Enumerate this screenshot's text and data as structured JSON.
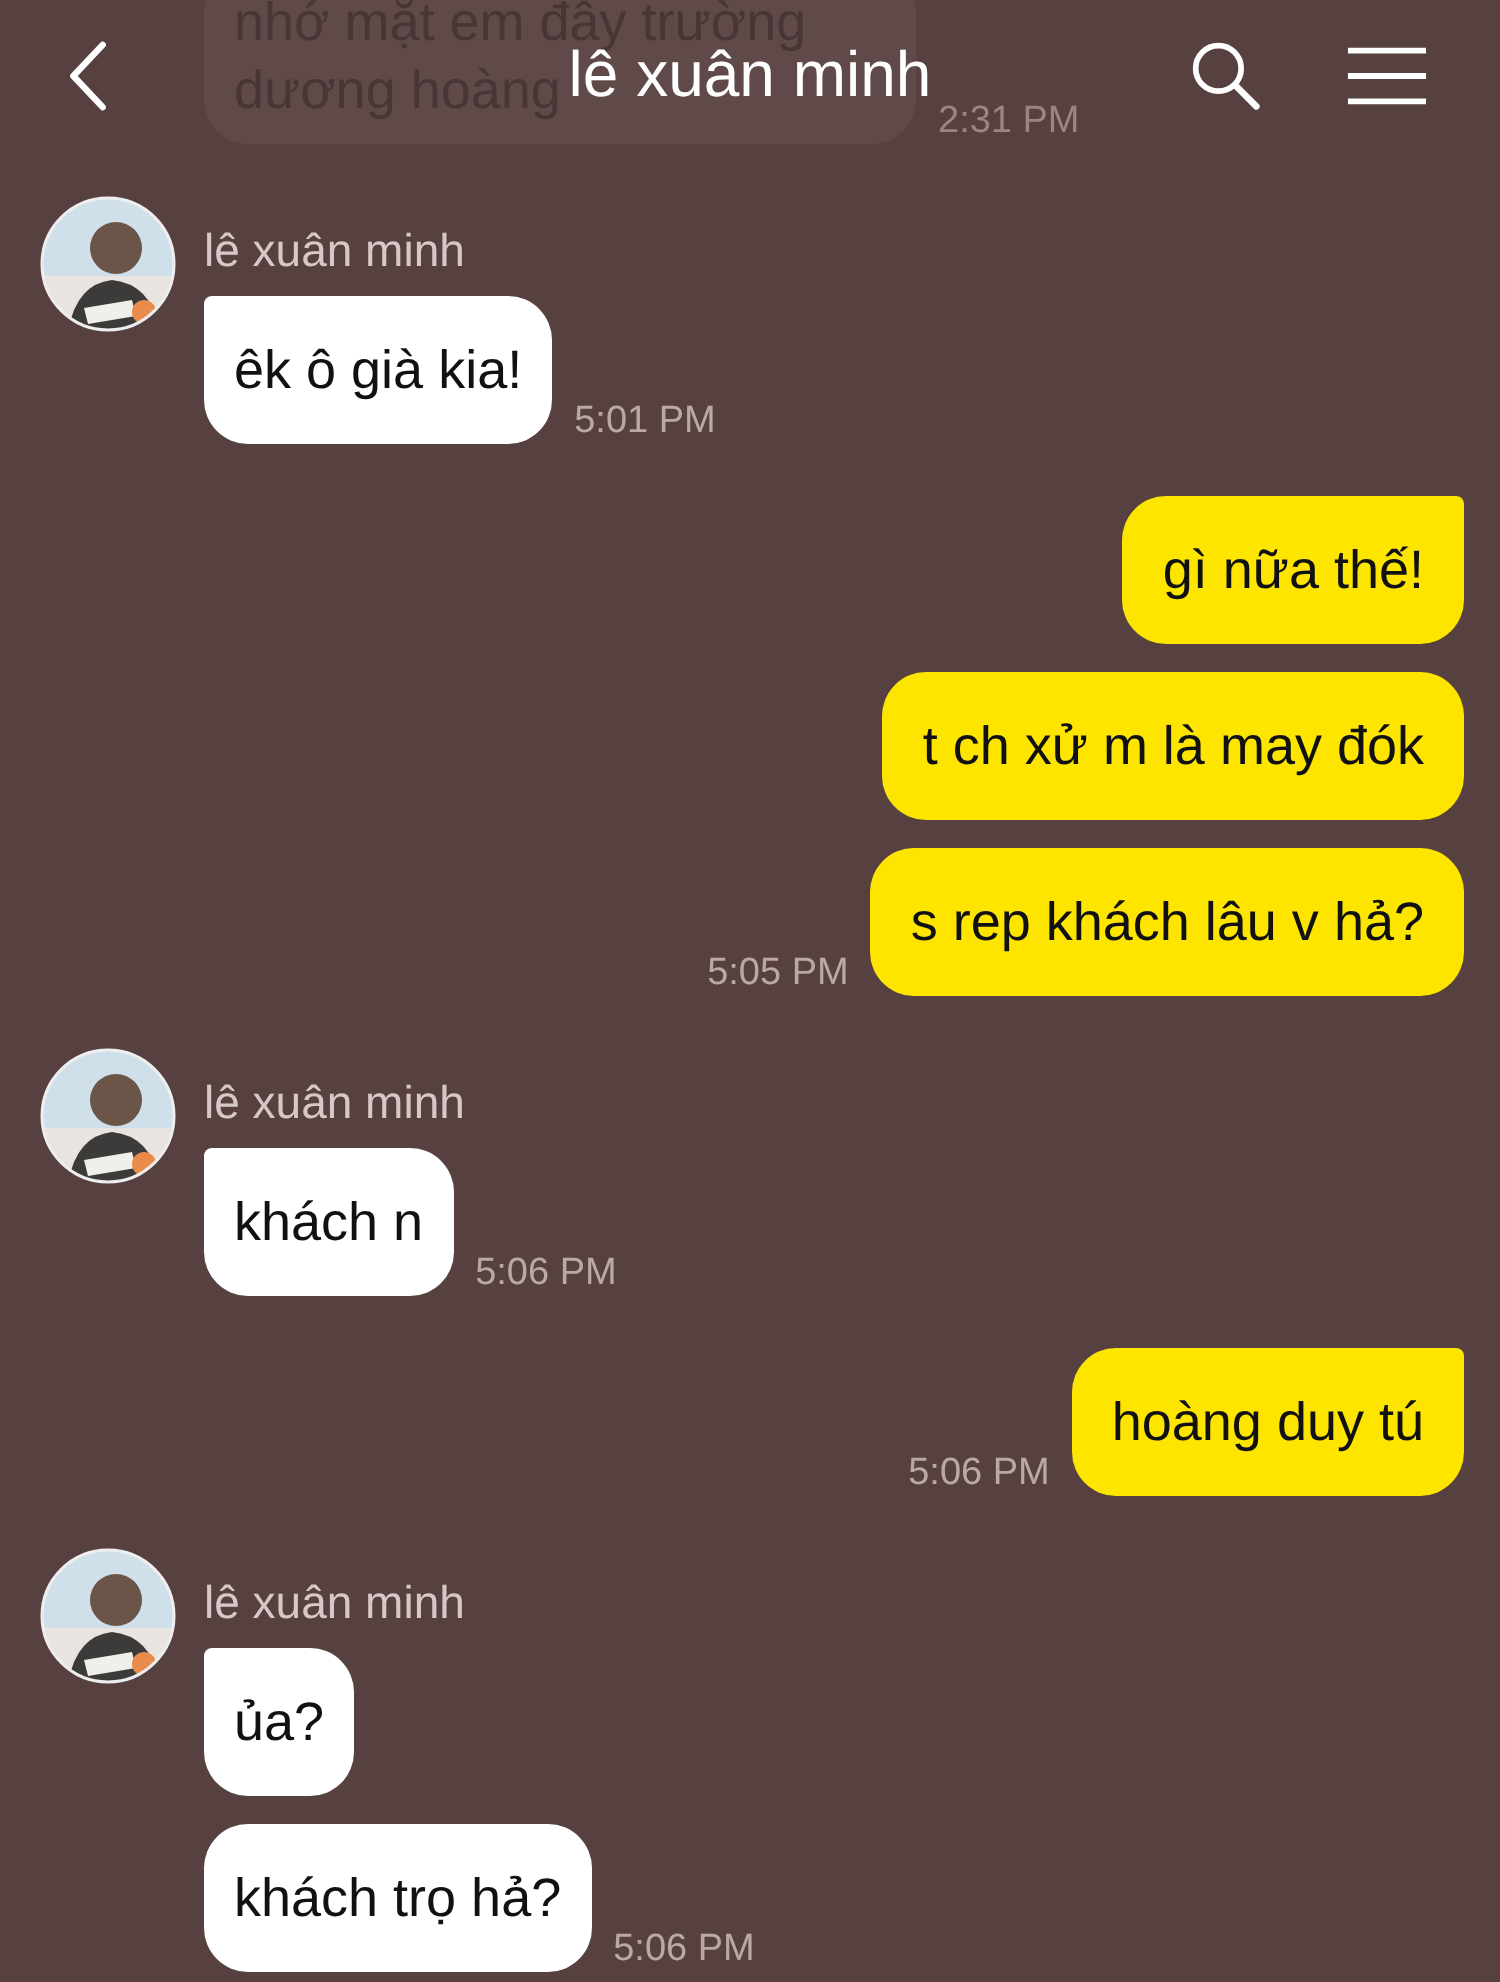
{
  "header": {
    "title": "lê xuân minh"
  },
  "messages": [
    {
      "outgoing": false,
      "faded": true,
      "bubbles": [
        "nhớ mặt em đây trường dương hoàng"
      ],
      "time": "2:31 PM"
    },
    {
      "outgoing": false,
      "sender": "lê xuân minh",
      "bubbles": [
        "êk ô già kia!"
      ],
      "time": "5:01 PM"
    },
    {
      "outgoing": true,
      "bubbles": [
        "gì nữa thế!",
        "t ch xử m là may đók",
        "s rep khách lâu v hả?"
      ],
      "time": "5:05 PM"
    },
    {
      "outgoing": false,
      "sender": "lê xuân minh",
      "bubbles": [
        "khách n"
      ],
      "time": "5:06 PM"
    },
    {
      "outgoing": true,
      "bubbles": [
        "hoàng duy tú"
      ],
      "time": "5:06 PM"
    },
    {
      "outgoing": false,
      "sender": "lê xuân minh",
      "bubbles": [
        "ủa?",
        "khách trọ hả?"
      ],
      "time": "5:06 PM"
    }
  ]
}
